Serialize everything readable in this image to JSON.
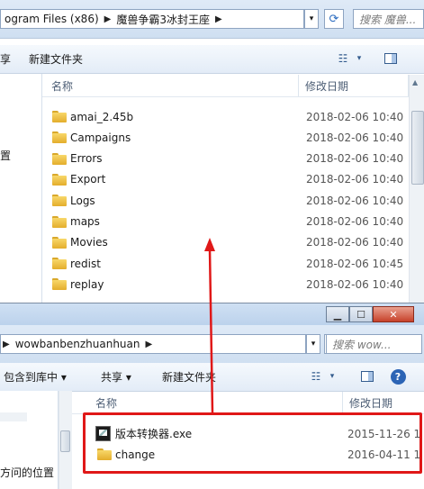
{
  "top_window": {
    "address": {
      "crumbs": [
        "ogram Files (x86)",
        "魔兽争霸3冰封王座"
      ],
      "search_placeholder": "搜索 魔兽..."
    },
    "toolbar": {
      "left_fragment": "享",
      "new_folder": "新建文件夹"
    },
    "nav_fragment": "置",
    "columns": {
      "name": "名称",
      "date": "修改日期"
    },
    "files": [
      {
        "name": "amai_2.45b",
        "date": "2018-02-06 10:40"
      },
      {
        "name": "Campaigns",
        "date": "2018-02-06 10:40"
      },
      {
        "name": "Errors",
        "date": "2018-02-06 10:40"
      },
      {
        "name": "Export",
        "date": "2018-02-06 10:40"
      },
      {
        "name": "Logs",
        "date": "2018-02-06 10:40"
      },
      {
        "name": "maps",
        "date": "2018-02-06 10:40"
      },
      {
        "name": "Movies",
        "date": "2018-02-06 10:40"
      },
      {
        "name": "redist",
        "date": "2018-02-06 10:45"
      },
      {
        "name": "replay",
        "date": "2018-02-06 10:40"
      }
    ]
  },
  "bottom_window": {
    "address": {
      "crumbs": [
        "wowbanbenzhuanhuan"
      ],
      "search_placeholder": "搜索 wow..."
    },
    "toolbar": {
      "include_library": "包含到库中 ▾",
      "share": "共享 ▾",
      "new_folder": "新建文件夹"
    },
    "nav_fragment": "方问的位置",
    "columns": {
      "name": "名称",
      "date": "修改日期"
    },
    "files": [
      {
        "name": "版本转换器.exe",
        "date": "2015-11-26 1",
        "icon": "exe-icon"
      },
      {
        "name": "change",
        "date": "2016-04-11 1",
        "icon": "folder-icon"
      }
    ]
  },
  "colors": {
    "highlight": "#e01818",
    "arrow": "#e01818"
  }
}
